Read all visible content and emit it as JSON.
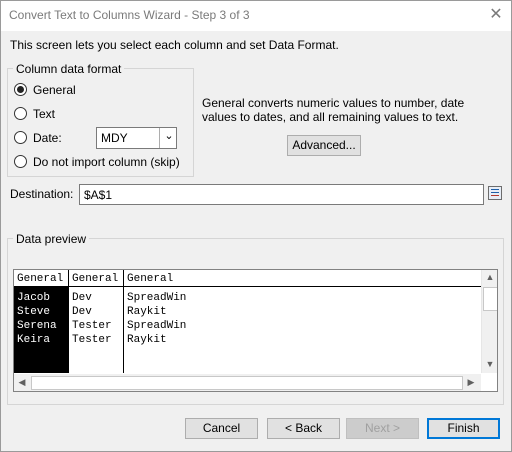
{
  "window": {
    "title": "Convert Text to Columns Wizard - Step 3 of 3"
  },
  "intro": "This screen lets you select each column and set Data Format.",
  "format_group": {
    "label": "Column data format",
    "options": [
      "General",
      "Text",
      "Date:",
      "Do not import column (skip)"
    ],
    "selected": "General",
    "date_format": "MDY"
  },
  "description": "General converts numeric values to number, date values to dates, and all remaining values to text.",
  "advanced_label": "Advanced...",
  "destination": {
    "label": "Destination:",
    "value": "$A$1"
  },
  "preview": {
    "label": "Data preview",
    "headers": [
      "General",
      "General",
      "General"
    ],
    "rows": [
      [
        "Jacob",
        "Dev",
        "SpreadWin"
      ],
      [
        "Steve",
        "Dev",
        "Raykit"
      ],
      [
        "Serena",
        "Tester",
        "SpreadWin"
      ],
      [
        "Keira",
        "Tester",
        "Raykit"
      ]
    ]
  },
  "buttons": {
    "cancel": "Cancel",
    "back": "< Back",
    "next": "Next >",
    "finish": "Finish"
  },
  "colors": {
    "accent": "#0078d7",
    "selected_column_bg": "#000000"
  }
}
